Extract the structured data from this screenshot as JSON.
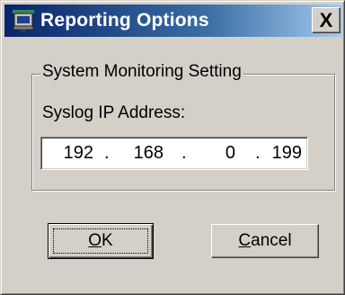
{
  "window": {
    "title": "Reporting Options",
    "close_glyph": "X",
    "icon": "monitor-network-icon"
  },
  "group": {
    "legend": "System Monitoring Setting",
    "field_label": "Syslog IP Address:"
  },
  "ip": {
    "octet1": "192",
    "octet2": "168",
    "octet3": "0",
    "octet4": "199",
    "dot": "."
  },
  "buttons": {
    "ok_mnemonic": "O",
    "ok_rest": "K",
    "cancel_mnemonic": "C",
    "cancel_rest": "ancel"
  },
  "colors": {
    "title_start": "#0a246a",
    "title_end": "#a6caf0",
    "face": "#d4d0c8"
  }
}
